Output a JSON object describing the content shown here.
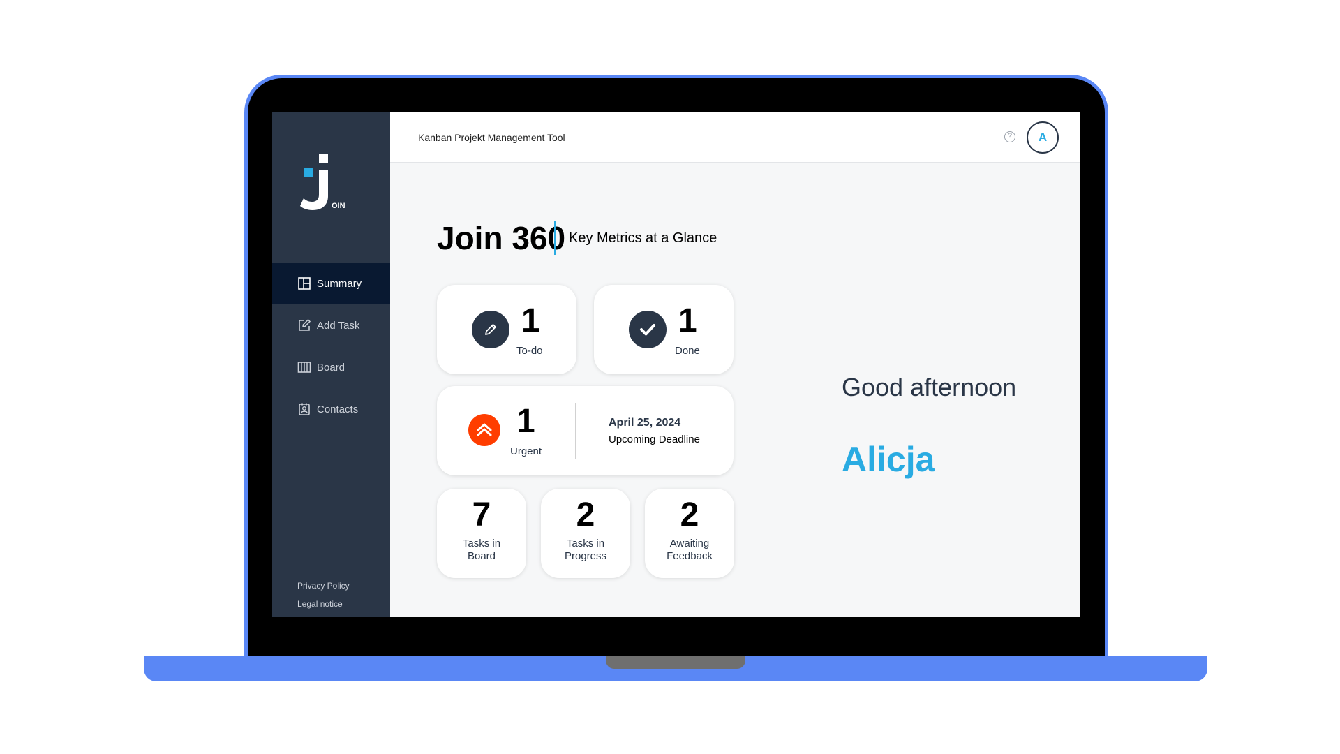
{
  "app": {
    "logo_suffix": "OIN",
    "header_title": "Kanban Projekt Management Tool",
    "help_glyph": "?",
    "avatar_initial": "A"
  },
  "sidebar": {
    "items": [
      {
        "label": "Summary",
        "icon": "summary-icon",
        "active": true
      },
      {
        "label": "Add Task",
        "icon": "add-task-icon",
        "active": false
      },
      {
        "label": "Board",
        "icon": "board-icon",
        "active": false
      },
      {
        "label": "Contacts",
        "icon": "contacts-icon",
        "active": false
      }
    ],
    "privacy": "Privacy Policy",
    "legal": "Legal notice"
  },
  "summary": {
    "title": "Join 360",
    "subtitle": "Key Metrics at a Glance",
    "todo": {
      "count": "1",
      "label": "To-do"
    },
    "done": {
      "count": "1",
      "label": "Done"
    },
    "urgent": {
      "count": "1",
      "label": "Urgent"
    },
    "deadline": {
      "date": "April 25, 2024",
      "label": "Upcoming Deadline"
    },
    "board": {
      "count": "7",
      "label": "Tasks in Board"
    },
    "progress": {
      "count": "2",
      "label": "Tasks in Progress"
    },
    "feedback": {
      "count": "2",
      "label": "Awaiting Feedback"
    }
  },
  "greeting": {
    "text": "Good afternoon",
    "name": "Alicja"
  },
  "colors": {
    "sidebar": "#2a3647",
    "active_nav": "#091931",
    "accent": "#29abe2",
    "urgent": "#ff3d00",
    "laptop_frame": "#5a87f5"
  }
}
